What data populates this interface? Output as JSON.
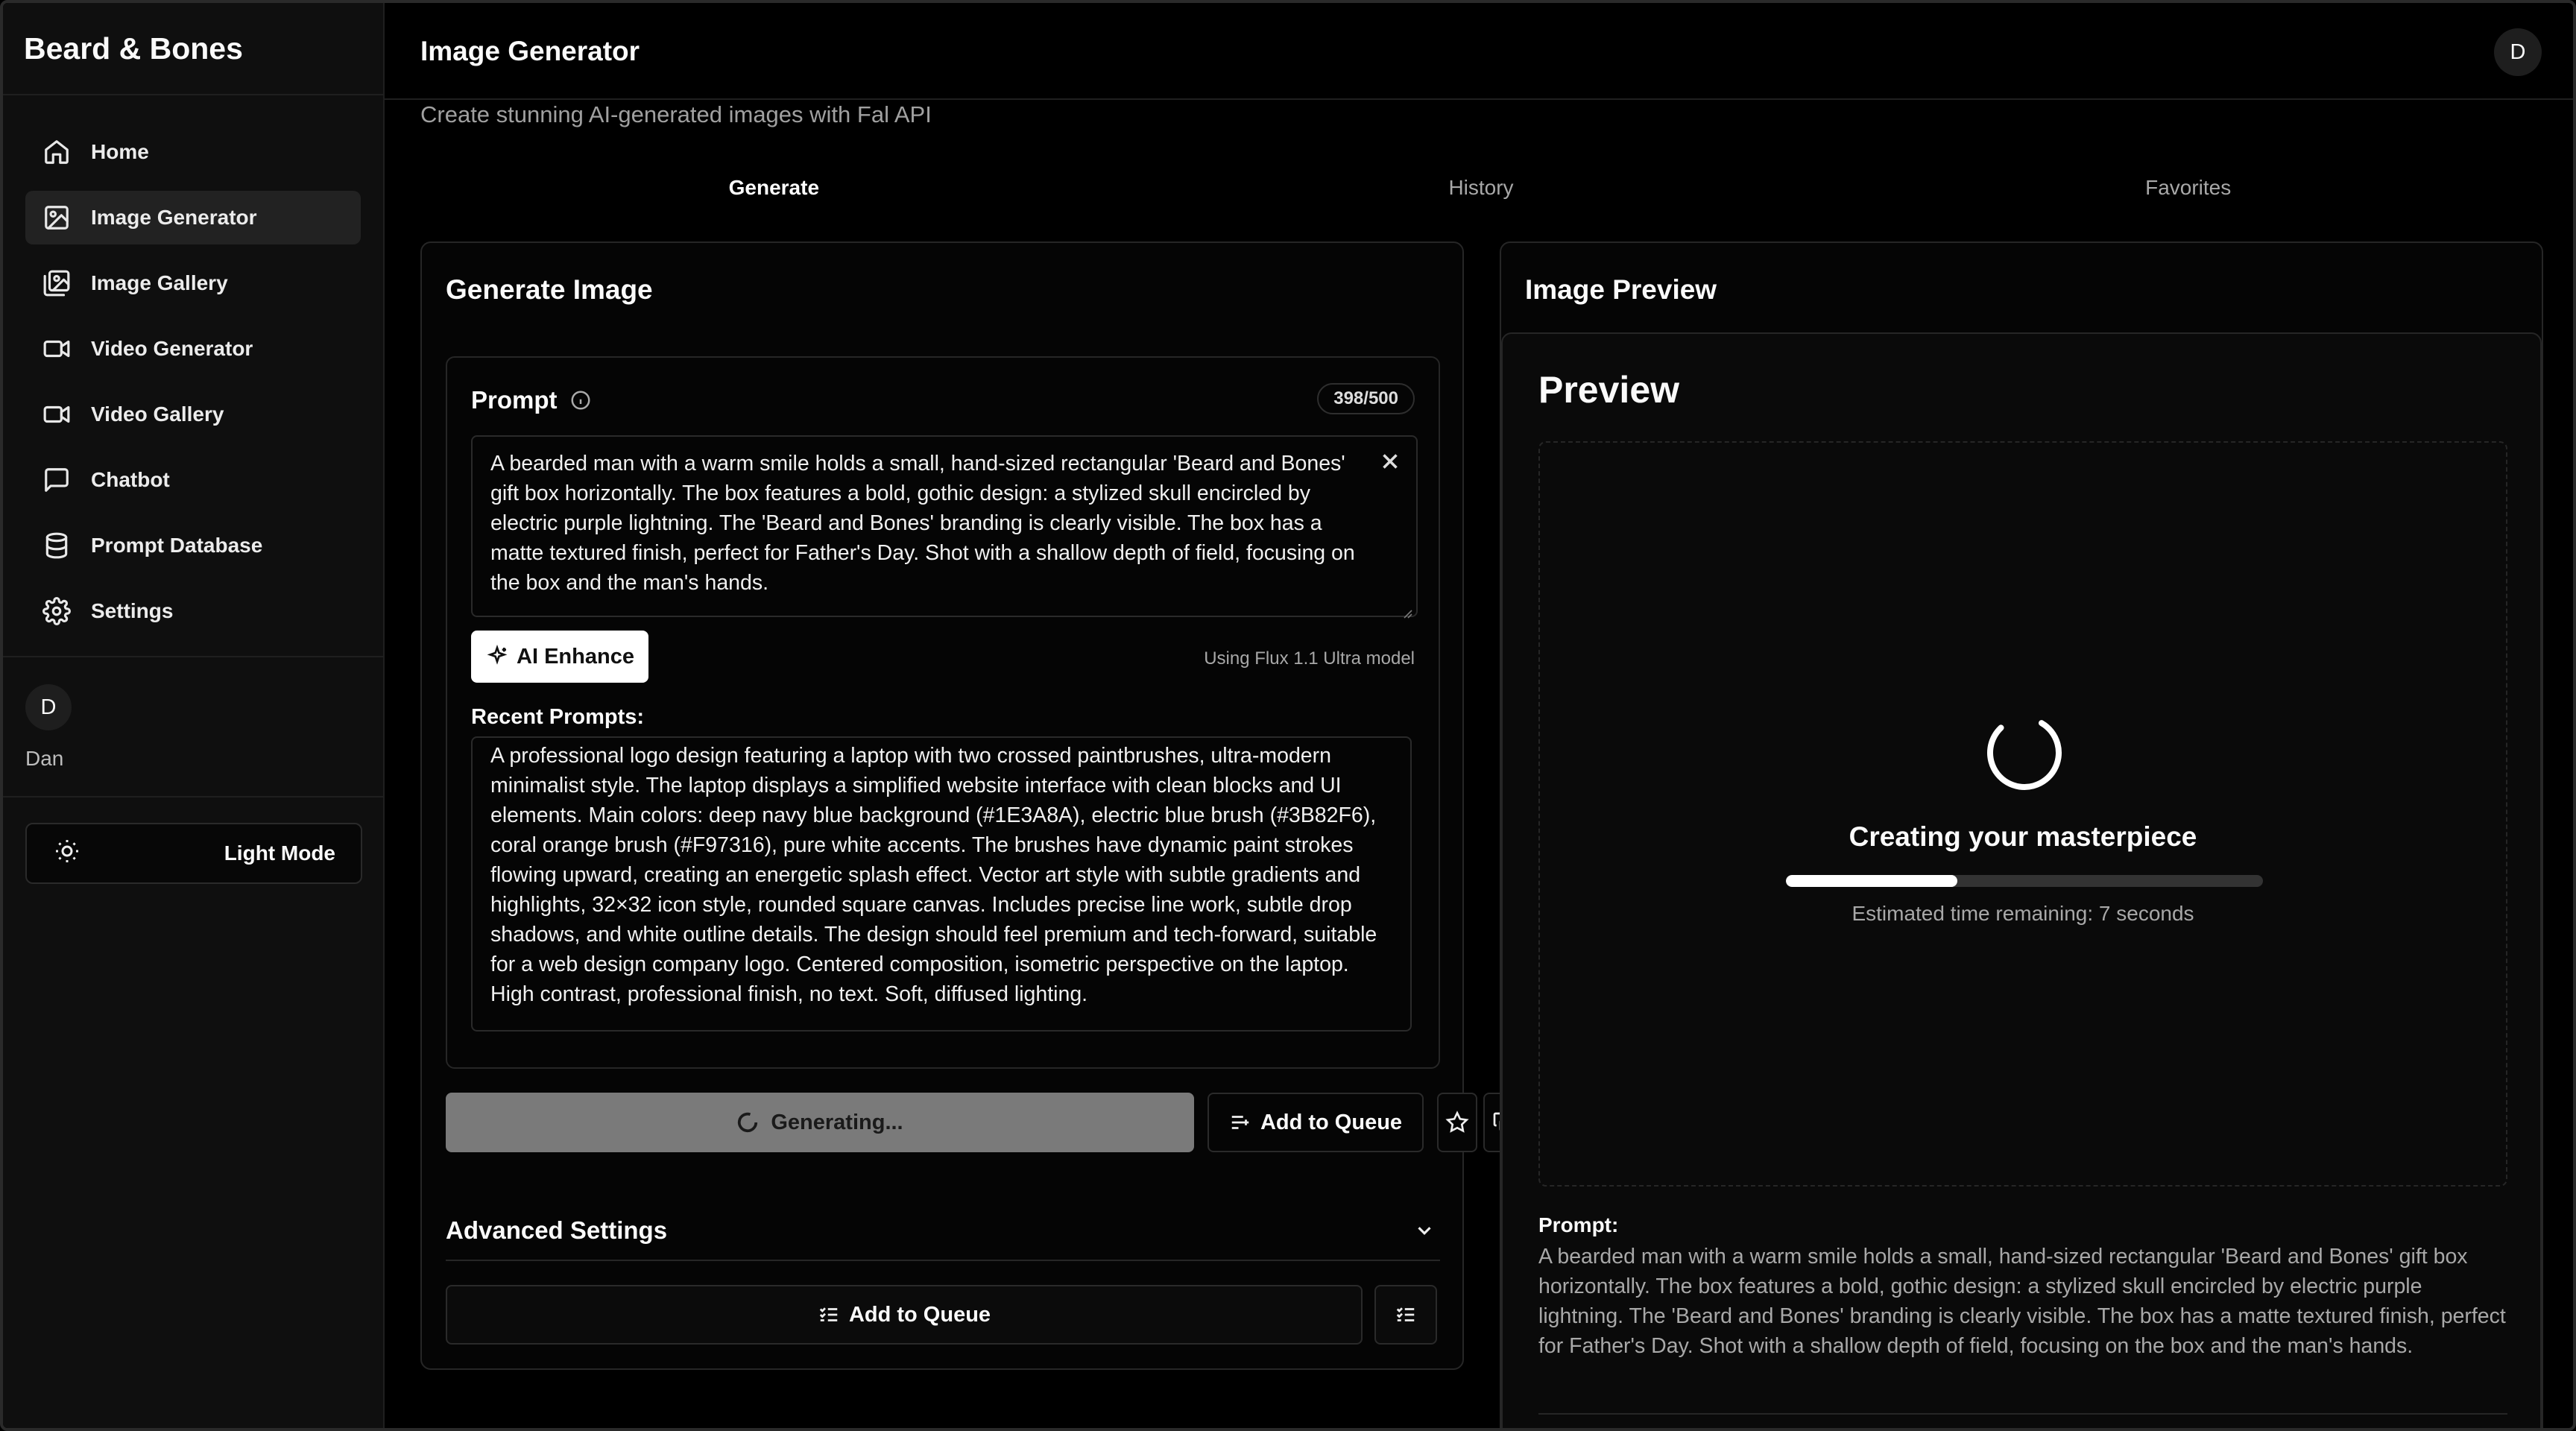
{
  "app": {
    "brand": "Beard & Bones"
  },
  "sidebar": {
    "items": [
      {
        "label": "Home",
        "icon": "home-icon"
      },
      {
        "label": "Image Generator",
        "icon": "image-icon",
        "active": true
      },
      {
        "label": "Image Gallery",
        "icon": "gallery-icon"
      },
      {
        "label": "Video Generator",
        "icon": "video-icon"
      },
      {
        "label": "Video Gallery",
        "icon": "video-icon"
      },
      {
        "label": "Chatbot",
        "icon": "chat-icon"
      },
      {
        "label": "Prompt Database",
        "icon": "database-icon"
      },
      {
        "label": "Settings",
        "icon": "gear-icon"
      }
    ],
    "user": {
      "initial": "D",
      "name": "Dan"
    },
    "theme_label": "Light Mode"
  },
  "header": {
    "title": "Image Generator",
    "subtitle": "Create stunning AI-generated images with Fal API",
    "avatar_initial": "D"
  },
  "tabs": [
    {
      "label": "Generate",
      "active": true
    },
    {
      "label": "History"
    },
    {
      "label": "Favorites"
    }
  ],
  "generate": {
    "card_title": "Generate Image",
    "prompt_label": "Prompt",
    "counter": "398/500",
    "prompt_value": "A bearded man with a warm smile holds a small, hand-sized rectangular 'Beard and Bones' gift box horizontally. The box features a bold, gothic design: a stylized skull encircled by electric purple lightning. The 'Beard and Bones' branding is clearly visible. The box has a matte textured finish, perfect for Father's Day. Shot with a shallow depth of field, focusing on the box and the man's hands.",
    "enhance_label": "AI Enhance",
    "model_note": "Using Flux 1.1 Ultra model",
    "recent_label": "Recent Prompts:",
    "recent_prompt": "A professional logo design featuring a laptop with two crossed paintbrushes, ultra-modern minimalist style. The laptop displays a simplified website interface with clean blocks and UI elements. Main colors: deep navy blue background (#1E3A8A), electric blue brush (#3B82F6), coral orange brush (#F97316), pure white accents. The brushes have dynamic paint strokes flowing upward, creating an energetic splash effect. Vector art style with subtle gradients and highlights, 32×32 icon style, rounded square canvas. Includes precise line work, subtle drop shadows, and white outline details. The design should feel premium and tech-forward, suitable for a web design company logo. Centered composition, isometric perspective on the laptop. High contrast, professional finish, no text. Soft, diffused lighting.",
    "generating_label": "Generating...",
    "queue_label": "Add to Queue",
    "advanced_label": "Advanced Settings",
    "queue_label_2": "Add to Queue"
  },
  "preview": {
    "card_title": "Image Preview",
    "heading": "Preview",
    "status": "Creating your masterpiece",
    "progress": 0.36,
    "estimate": "Estimated time remaining: 7 seconds",
    "prompt_head": "Prompt:",
    "prompt_body": "A bearded man with a warm smile holds a small, hand-sized rectangular 'Beard and Bones' gift box horizontally. The box features a bold, gothic design: a stylized skull encircled by electric purple lightning. The 'Beard and Bones' branding is clearly visible. The box has a matte textured finish, perfect for Father's Day. Shot with a shallow depth of field, focusing on the box and the man's hands."
  },
  "colors": {
    "background": "#000000",
    "sidebar": "#0f0f0f",
    "accent": "#ffffff",
    "button_disabled": "#7a7a7a"
  }
}
